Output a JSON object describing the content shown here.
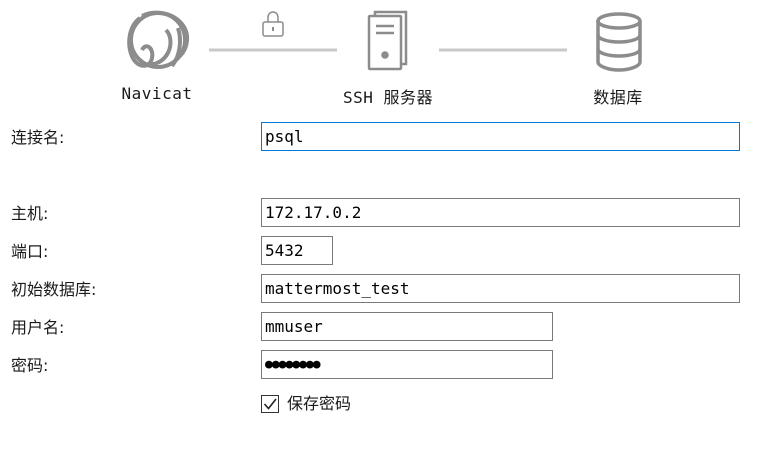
{
  "diagram": {
    "nodes": [
      {
        "label": "Navicat",
        "icon": "navicat-icon"
      },
      {
        "label": "SSH 服务器",
        "icon": "server-icon"
      },
      {
        "label": "数据库",
        "icon": "database-icon"
      }
    ],
    "lock_icon": "lock-icon"
  },
  "form": {
    "connection_name": {
      "label": "连接名:",
      "value": "psql"
    },
    "host": {
      "label": "主机:",
      "value": "172.17.0.2"
    },
    "port": {
      "label": "端口:",
      "value": "5432"
    },
    "initial_db": {
      "label": "初始数据库:",
      "value": "mattermost_test"
    },
    "username": {
      "label": "用户名:",
      "value": "mmuser"
    },
    "password": {
      "label": "密码:",
      "value": "●●●●●●●●"
    },
    "save_password": {
      "label": "保存密码",
      "checked": true
    }
  },
  "colors": {
    "icon_gray": "#8c8c8c",
    "focus_border": "#0078d7",
    "field_border": "#7a7a7a"
  }
}
